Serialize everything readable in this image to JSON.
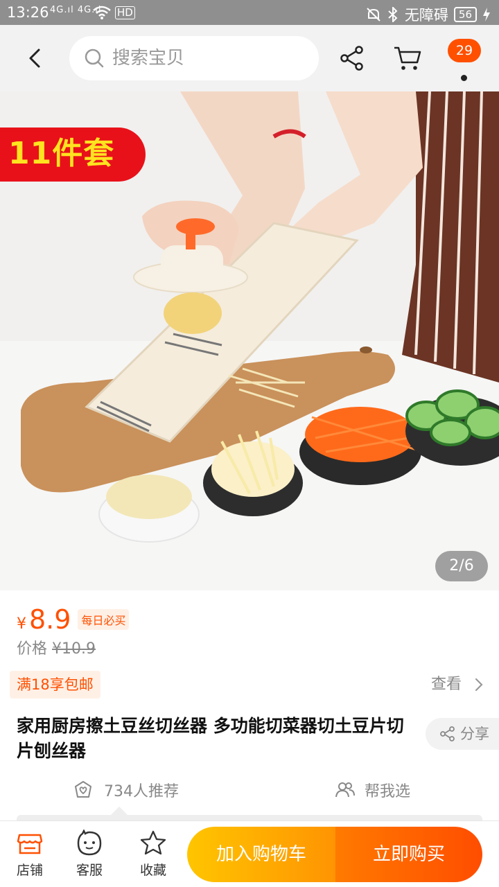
{
  "status_bar": {
    "time": "13:26",
    "signals": "4G.ıl 4G.ıl",
    "wifi_label": "HD",
    "accessibility": "无障碍",
    "battery": "56",
    "icons": [
      "signal-icon",
      "wifi-icon",
      "mute-icon",
      "bluetooth-icon",
      "battery-icon",
      "charging-icon"
    ]
  },
  "nav": {
    "search_placeholder": "搜索宝贝",
    "cart_badge": "29",
    "icons": [
      "back-icon",
      "search-icon",
      "share-icon",
      "cart-icon",
      "more-icon"
    ]
  },
  "image": {
    "promo": "11件套",
    "pager": "2/6"
  },
  "price": {
    "currency": "¥",
    "current": "8.9",
    "tag": "每日必买",
    "orig_label": "价格",
    "orig_value": "¥10.9"
  },
  "shipping": {
    "tag": "满18享包邮",
    "view": "查看"
  },
  "product": {
    "title": "家用厨房擦土豆丝切丝器 多功能切菜器切土豆片切片刨丝器",
    "share": "分享"
  },
  "social": {
    "recommend": "734人推荐",
    "help": "帮我选"
  },
  "bottom": {
    "store": "店铺",
    "service": "客服",
    "favorite": "收藏",
    "add_cart": "加入购物车",
    "buy_now": "立即购买"
  },
  "colors": {
    "accent": "#ff5000",
    "promo_red": "#e8111a",
    "promo_yellow": "#ffe320",
    "cart_button": "#ffa800",
    "buy_button": "#ff5a00"
  }
}
